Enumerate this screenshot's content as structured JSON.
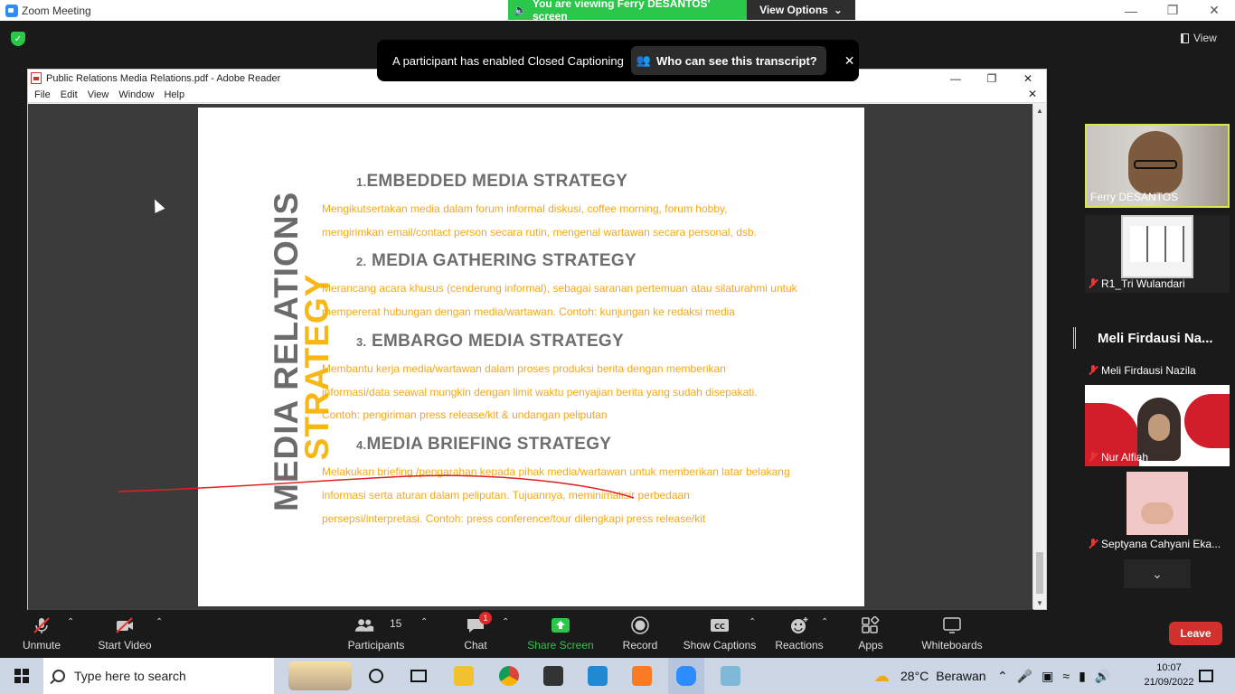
{
  "window": {
    "title": "Zoom Meeting",
    "share_banner": "You are viewing Ferry DESANTOS' screen",
    "view_options": "View Options",
    "view_label": "View"
  },
  "notice": {
    "message": "A participant has enabled Closed Captioning",
    "who_link": "Who can see this transcript?",
    "close": "✕"
  },
  "adobe": {
    "title": "Public Relations Media Relations.pdf - Adobe Reader",
    "menu": [
      "File",
      "Edit",
      "View",
      "Window",
      "Help"
    ]
  },
  "slide": {
    "vertical_title_gray": "MEDIA RELATIONS",
    "vertical_title_yellow": "STRATEGY",
    "sections": [
      {
        "num": "1.",
        "heading": "EMBEDDED MEDIA STRATEGY",
        "lines": [
          "Mengikutsertakan media dalam forum informal diskusi, coffee morning, forum hobby,",
          "mengirimkan email/contact person secara rutin, mengenal wartawan secara personal, dsb."
        ]
      },
      {
        "num": "2.",
        "heading": "MEDIA GATHERING STRATEGY",
        "lines": [
          "Merancang acara khusus (cenderung informal), sebagai saranan pertemuan atau silaturahmi untuk",
          "mempererat hubungan dengan media/wartawan. Contoh: kunjungan ke redaksi media"
        ]
      },
      {
        "num": "3.",
        "heading": "EMBARGO MEDIA STRATEGY",
        "lines": [
          "Membantu kerja media/wartawan dalam proses produksi berita dengan memberikan",
          "informasi/data seawal mungkin dengan limit waktu penyajian berita yang sudah disepakati.",
          "Contoh: pengiriman press release/kit & undangan peliputan"
        ]
      },
      {
        "num": "4.",
        "heading": "MEDIA BRIEFING STRATEGY",
        "lines": [
          "Melakukan briefing /pengarahan kepada pihak media/wartawan untuk memberikan latar belakang",
          "informasi serta aturan dalam peliputan. Tujuannya, meminimalisir perbedaan",
          "persepsi/interpretasi. Contoh: press conference/tour dilengkapi press release/kit"
        ]
      }
    ]
  },
  "participants_panel": {
    "tiles": [
      {
        "name": "Ferry DESANTOS",
        "muted": false
      },
      {
        "name": "R1_Tri Wulandari",
        "muted": true
      },
      {
        "name": "Meli Firdausi Nazila",
        "display": "Meli Firdausi Na...",
        "muted": true
      },
      {
        "name": "Nur Alfiah",
        "muted": true
      },
      {
        "name": "Septyana Cahyani Eka...",
        "muted": true
      }
    ]
  },
  "toolbar": {
    "unmute": "Unmute",
    "start_video": "Start Video",
    "participants": "Participants",
    "participants_count": "15",
    "chat": "Chat",
    "chat_badge": "1",
    "share_screen": "Share Screen",
    "record": "Record",
    "show_captions": "Show Captions",
    "reactions": "Reactions",
    "apps": "Apps",
    "whiteboards": "Whiteboards",
    "leave": "Leave"
  },
  "taskbar": {
    "search_placeholder": "Type here to search",
    "weather_temp": "28°C",
    "weather_text": "Berawan",
    "time": "10:07",
    "date": "21/09/2022"
  },
  "colors": {
    "zoom_green": "#2bc74a",
    "leave_red": "#d3312d",
    "slide_orange": "#f5a816",
    "slide_gray": "#6e6e6e",
    "annotation_red": "#e02020"
  }
}
